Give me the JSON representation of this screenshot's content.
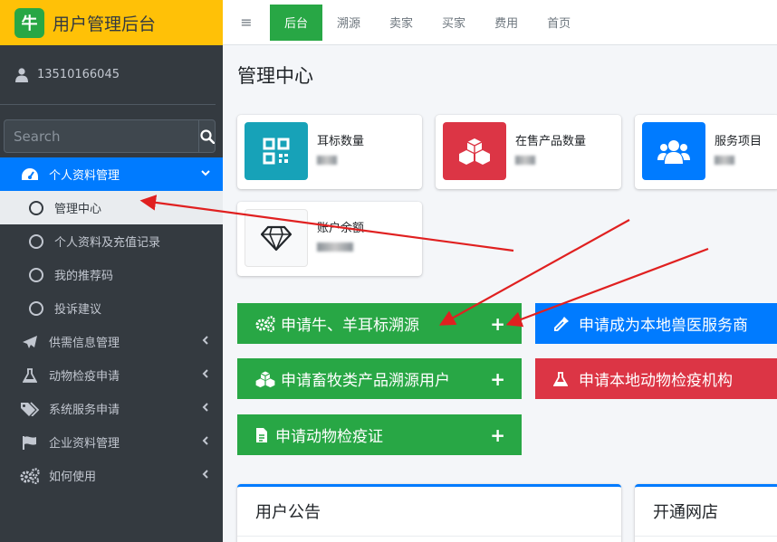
{
  "brand": {
    "logo": "牛",
    "title": "用户管理后台"
  },
  "user": {
    "name": "13510166045"
  },
  "search": {
    "placeholder": "Search"
  },
  "sidebar": {
    "items": [
      {
        "label": "个人资料管理",
        "icon": "tachometer-icon"
      },
      {
        "label": "供需信息管理",
        "icon": "send-icon"
      },
      {
        "label": "动物检疫申请",
        "icon": "flask-icon"
      },
      {
        "label": "系统服务申请",
        "icon": "tags-icon"
      },
      {
        "label": "企业资料管理",
        "icon": "flag-icon"
      },
      {
        "label": "如何使用",
        "icon": "cogs-icon"
      }
    ],
    "subitems": [
      {
        "label": "管理中心"
      },
      {
        "label": "个人资料及充值记录"
      },
      {
        "label": "我的推荐码"
      },
      {
        "label": "投诉建议"
      }
    ]
  },
  "topnav": {
    "menu_icon": "≡",
    "links": [
      "后台",
      "溯源",
      "卖家",
      "买家",
      "费用",
      "首页"
    ]
  },
  "page": {
    "title": "管理中心"
  },
  "info_boxes": [
    {
      "label": "耳标数量",
      "color": "#17a2b8",
      "icon": "qrcode-icon"
    },
    {
      "label": "在售产品数量",
      "color": "#dc3545",
      "icon": "cubes-icon"
    },
    {
      "label": "服务项目",
      "color": "#007bff",
      "icon": "users-icon"
    },
    {
      "label": "账户余额",
      "color": "#f8f9fa",
      "icon": "diamond-icon"
    }
  ],
  "actions": [
    {
      "label": "申请牛、羊耳标溯源",
      "plus": "+",
      "color": "#28a745"
    },
    {
      "label": "申请成为本地兽医服务商",
      "color": "#007bff"
    },
    {
      "label": "申请畜牧类产品溯源用户",
      "plus": "+",
      "color": "#28a745"
    },
    {
      "label": "申请本地动物检疫机构",
      "color": "#dc3545"
    },
    {
      "label": "申请动物检疫证",
      "plus": "+",
      "color": "#28a745"
    }
  ],
  "cards": [
    {
      "title": "用户公告"
    },
    {
      "title": "开通网店"
    }
  ]
}
